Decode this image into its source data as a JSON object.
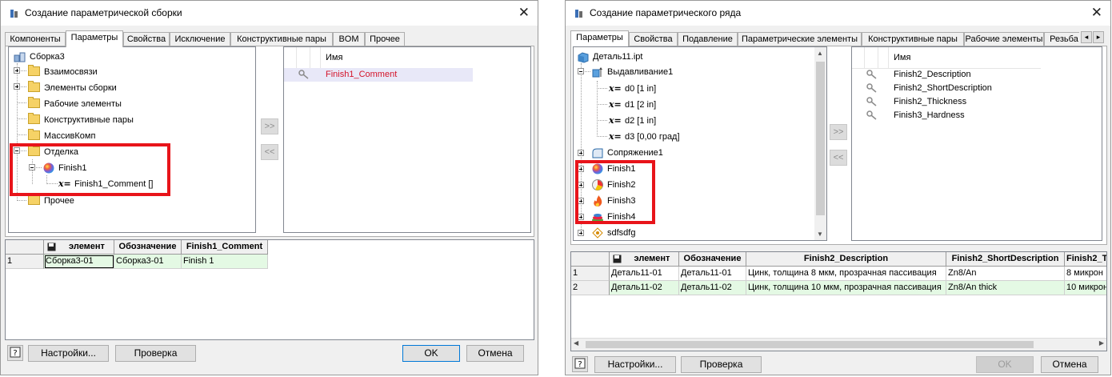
{
  "left_window": {
    "title": "Создание параметрической сборки",
    "tabs": [
      "Компоненты",
      "Параметры",
      "Свойства",
      "Исключение",
      "Конструктивные пары",
      "BOM",
      "Прочее"
    ],
    "active_tab": "Параметры",
    "tree": {
      "root": "Сборка3",
      "items": [
        "Взаимосвязи",
        "Элементы сборки",
        "Рабочие элементы",
        "Конструктивные пары",
        "МассивКомп",
        "Отделка"
      ],
      "finish": "Finish1",
      "finish_param": "Finish1_Comment []",
      "last": "Прочее"
    },
    "add_button": ">>",
    "remove_button": "<<",
    "selected_header": "Имя",
    "selected_item": "Finish1_Comment",
    "table": {
      "headers": [
        "элемент",
        "Обозначение",
        "Finish1_Comment"
      ],
      "rows": [
        {
          "num": "1",
          "cells": [
            "Сборка3-01",
            "Сборка3-01",
            "Finish 1"
          ]
        }
      ]
    },
    "buttons": {
      "help": "?",
      "settings": "Настройки...",
      "check": "Проверка",
      "ok": "OK",
      "cancel": "Отмена"
    }
  },
  "right_window": {
    "title": "Создание параметрического ряда",
    "tabs": [
      "Параметры",
      "Свойства",
      "Подавление",
      "Параметрические элементы",
      "Конструктивные пары",
      "Рабочие элементы",
      "Резьба"
    ],
    "active_tab": "Параметры",
    "tab_scroll_left": "◂",
    "tab_scroll_right": "▸",
    "tree": {
      "root": "Деталь11.ipt",
      "extrusion": "Выдавливание1",
      "params": [
        "d0 [1 in]",
        "d1 [2 in]",
        "d2 [1 in]",
        "d3 [0,00 град]"
      ],
      "fillet": "Сопряжение1",
      "finishes": [
        "Finish1",
        "Finish2",
        "Finish3",
        "Finish4"
      ],
      "last": "sdfsdfg"
    },
    "add_button": ">>",
    "remove_button": "<<",
    "selected_header": "Имя",
    "selected_items": [
      "Finish2_Description",
      "Finish2_ShortDescription",
      "Finish2_Thickness",
      "Finish3_Hardness"
    ],
    "table": {
      "headers": [
        "элемент",
        "Обозначение",
        "Finish2_Description",
        "Finish2_ShortDescription",
        "Finish2_T"
      ],
      "rows": [
        {
          "num": "1",
          "cells": [
            "Деталь11-01",
            "Деталь11-01",
            "Цинк, толщина 8 мкм, прозрачная пассивация",
            "Zn8/An",
            "8 микрон"
          ]
        },
        {
          "num": "2",
          "cells": [
            "Деталь11-02",
            "Деталь11-02",
            "Цинк, толщина 10 мкм, прозрачная пассивация",
            "Zn8/An thick",
            "10 микрон"
          ]
        }
      ]
    },
    "buttons": {
      "help": "?",
      "settings": "Настройки...",
      "check": "Проверка",
      "ok": "OK",
      "cancel": "Отмена"
    }
  },
  "colors": {
    "highlight_red": "#e8141a",
    "selected_row": "#e8e8f8",
    "red_text": "#d4142a",
    "green_cell": "#e4f9e4"
  }
}
